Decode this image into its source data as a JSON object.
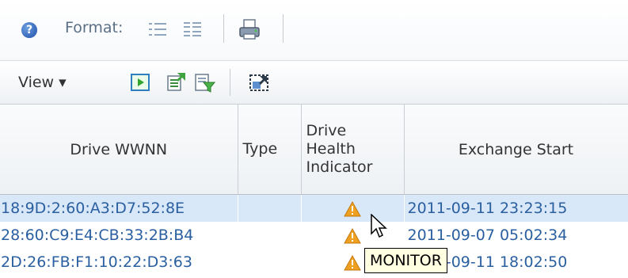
{
  "formatbar": {
    "help_icon": "help-icon",
    "help_glyph": "?",
    "format_label": "Format:",
    "list_view_icon": "list-view-icon",
    "detail_view_icon": "detail-view-icon",
    "print_icon": "print-icon"
  },
  "toolbar": {
    "view_label": "View ▾",
    "icons": [
      "run-report-icon",
      "export-icon",
      "filter-icon",
      "detach-icon"
    ]
  },
  "table": {
    "columns": [
      "Drive WWNN",
      "Type",
      "Drive Health Indicator",
      "Exchange Start"
    ],
    "rows": [
      {
        "wwnn": "18:9D:2:60:A3:D7:52:8E",
        "type": "",
        "health": "warning",
        "exchange_start": "2011-09-11 23:23:15",
        "selected": true
      },
      {
        "wwnn": "28:60:C9:E4:CB:33:2B:B4",
        "type": "",
        "health": "warning",
        "exchange_start": "2011-09-07 05:02:34",
        "selected": false
      },
      {
        "wwnn": "2D:26:FB:F1:10:22:D3:63",
        "type": "",
        "health": "warning",
        "exchange_start": "2011-09-11 18:02:50",
        "selected": false
      }
    ]
  },
  "tooltip": {
    "text": "MONITOR"
  },
  "colors": {
    "link": "#2a5fa0",
    "selected_row": "#d9e8f8",
    "warning": "#f0a020",
    "tooltip_bg": "#ffffe1"
  }
}
